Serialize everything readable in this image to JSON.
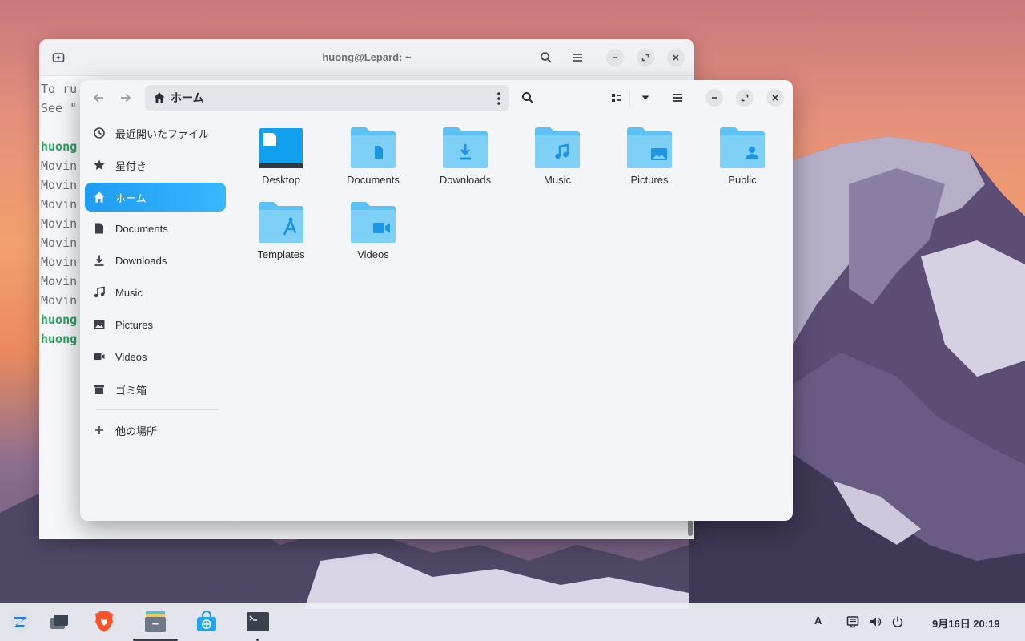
{
  "terminal": {
    "title": "huong@Lepard: ~",
    "lines": [
      {
        "text": "To ru",
        "green": false
      },
      {
        "text": "See \"",
        "green": false
      },
      {
        "text": "",
        "green": false
      },
      {
        "text": "huong",
        "green": true
      },
      {
        "text": "Movin",
        "green": false
      },
      {
        "text": "Movin",
        "green": false
      },
      {
        "text": "Movin",
        "green": false
      },
      {
        "text": "Movin",
        "green": false
      },
      {
        "text": "Movin",
        "green": false
      },
      {
        "text": "Movin",
        "green": false
      },
      {
        "text": "Movin",
        "green": false
      },
      {
        "text": "Movin",
        "green": false
      },
      {
        "text": "huong",
        "green": true
      },
      {
        "text": "huong",
        "green": true
      }
    ]
  },
  "files": {
    "path_label": "ホーム",
    "sidebar": {
      "items": [
        {
          "label": "最近開いたファイル",
          "icon": "recent-icon"
        },
        {
          "label": "星付き",
          "icon": "star-icon"
        },
        {
          "label": "ホーム",
          "icon": "home-icon",
          "active": true
        },
        {
          "label": "Documents",
          "icon": "document-icon"
        },
        {
          "label": "Downloads",
          "icon": "download-icon"
        },
        {
          "label": "Music",
          "icon": "music-icon"
        },
        {
          "label": "Pictures",
          "icon": "picture-icon"
        },
        {
          "label": "Videos",
          "icon": "video-icon"
        },
        {
          "label": "ゴミ箱",
          "icon": "trash-icon"
        }
      ],
      "other_locations": "他の場所"
    },
    "folders": [
      {
        "label": "Desktop",
        "icon": "desktop-folder-icon"
      },
      {
        "label": "Documents",
        "icon": "documents-folder-icon"
      },
      {
        "label": "Downloads",
        "icon": "downloads-folder-icon"
      },
      {
        "label": "Music",
        "icon": "music-folder-icon"
      },
      {
        "label": "Pictures",
        "icon": "pictures-folder-icon"
      },
      {
        "label": "Public",
        "icon": "public-folder-icon"
      },
      {
        "label": "Templates",
        "icon": "templates-folder-icon"
      },
      {
        "label": "Videos",
        "icon": "videos-folder-icon"
      }
    ]
  },
  "taskbar": {
    "keyboard_layout": "A",
    "clock": "9月16日  20:19"
  },
  "colors": {
    "accent": "#1f9cf0",
    "folder": "#5cc1f3",
    "folder_dark": "#2a9de6",
    "terminal_green": "#27a35d"
  }
}
